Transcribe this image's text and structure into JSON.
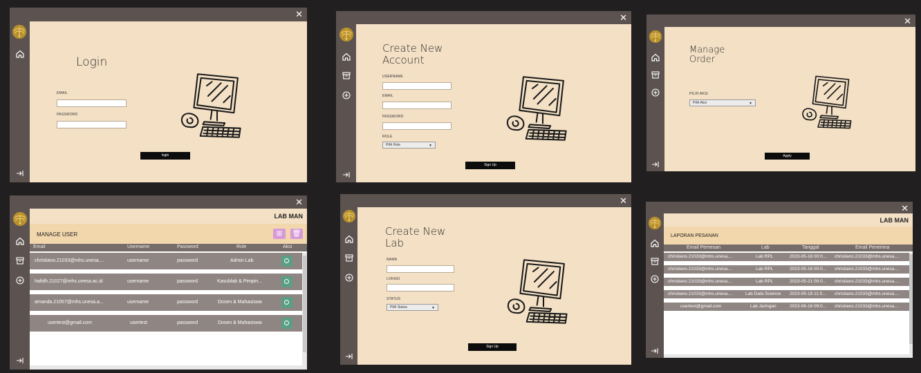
{
  "colors": {
    "background": "#211f1f",
    "sidebar": "#5c5350",
    "content": "#f3e0c5",
    "panel_header": "#f2d6ac",
    "table_header": "#766d6b",
    "table_row": "#8f8582",
    "action_green": "#5a9f85",
    "action_pink": "#d79ad9",
    "button": "#0c0c0c"
  },
  "close_glyph": "✕",
  "login": {
    "title": "Login",
    "email_label": "EMAIL",
    "password_label": "PASSWORD",
    "button": "login"
  },
  "create_account": {
    "title_line1": "Create New",
    "title_line2": "Account",
    "username_label": "USERNAME",
    "email_label": "EMAIL",
    "password_label": "PASSWORD",
    "role_label": "ROLE",
    "role_select": "Pilih Role",
    "button": "Sign Up"
  },
  "manage_order": {
    "title_line1": "Manage",
    "title_line2": "Order",
    "action_label": "PILIH AKSI",
    "action_select": "Pilih Aksi",
    "button": "Apply"
  },
  "manage_user": {
    "app_title": "LAB MAN",
    "panel_title": "MANAGE USER",
    "columns": [
      "Email",
      "Username",
      "Password",
      "Role",
      "Aksi"
    ],
    "rows": [
      {
        "email": "christiano.21033@mhs.unesa....",
        "username": "username",
        "password": "password",
        "role": "Admin Lab"
      },
      {
        "email": "hafidh.21027@mhs.unesa.ac.id",
        "username": "username",
        "password": "password",
        "role": "Kasublab & Pimpin..."
      },
      {
        "email": "amanda.21057@mhs.unesa.a...",
        "username": "username",
        "password": "password",
        "role": "Dosen & Mahasiswa"
      },
      {
        "email": "usertest@gmail.com",
        "username": "usertest",
        "password": "password",
        "role": "Dosen & Mahasiswa"
      }
    ]
  },
  "create_lab": {
    "title_line1": "Create New",
    "title_line2": "Lab",
    "name_label": "NAMA",
    "location_label": "LOKASI",
    "status_label": "STATUS",
    "status_select": "Pilih Status",
    "button": "Sign Up"
  },
  "order_report": {
    "app_title": "LAB MAN",
    "panel_title": "LAPORAN PESANAN",
    "columns": [
      "Email Pemesan",
      "Lab",
      "Tanggal",
      "Email Penerima"
    ],
    "rows": [
      {
        "email": "christiano.21033@mhs.unesa....",
        "lab": "Lab RPL",
        "date": "2023-05-16 00:0...",
        "receiver": "christiano.21033@mhs.unesa...."
      },
      {
        "email": "christiano.21033@mhs.unesa....",
        "lab": "Lab RPL",
        "date": "2023-05-16 00:0...",
        "receiver": "christiano.21033@mhs.unesa...."
      },
      {
        "email": "christiano.21033@mhs.unesa....",
        "lab": "Lab RPL",
        "date": "2023-05-21 09:0...",
        "receiver": "christiano.21033@mhs.unesa...."
      },
      {
        "email": "christiano.21033@mhs.unesa....",
        "lab": "Lab Data Science",
        "date": "2023-05-18 11:0...",
        "receiver": "christiano.21033@mhs.unesa...."
      },
      {
        "email": "usertest@gmail.com",
        "lab": "Lab Jaringan",
        "date": "2023-06-16 09:0...",
        "receiver": "christiano.21033@mhs.unesa...."
      }
    ]
  }
}
